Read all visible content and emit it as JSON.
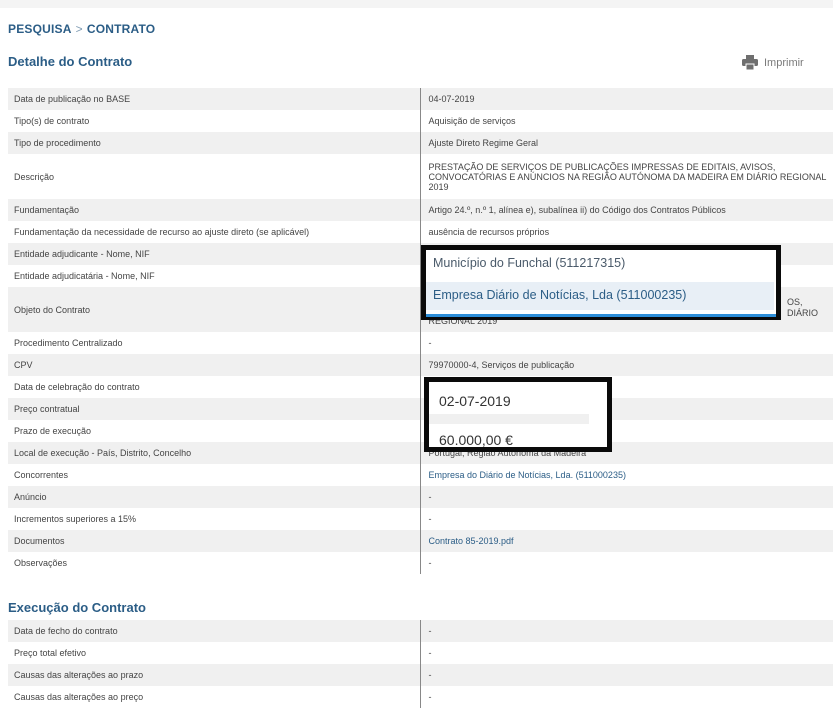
{
  "breadcrumb": {
    "part1": "PESQUISA",
    "sep": ">",
    "part2": "CONTRATO"
  },
  "detail": {
    "title": "Detalhe do Contrato",
    "print_label": "Imprimir",
    "print_icon": "printer-icon",
    "rows": [
      {
        "key": "Data de publicação no BASE",
        "value": "04-07-2019"
      },
      {
        "key": "Tipo(s) de contrato",
        "value": "Aquisição de serviços"
      },
      {
        "key": "Tipo de procedimento",
        "value": "Ajuste Direto Regime Geral"
      },
      {
        "key": "Descrição",
        "value": "PRESTAÇÃO DE SERVIÇOS DE PUBLICAÇÕES IMPRESSAS DE EDITAIS, AVISOS, CONVOCATÓRIAS E ANÚNCIOS NA REGIÃO AUTÓNOMA DA MADEIRA EM DIÁRIO REGIONAL 2019"
      },
      {
        "key": "Fundamentação",
        "value": "Artigo 24.º, n.º 1, alínea e), subalínea ii) do Código dos Contratos Públicos"
      },
      {
        "key": "Fundamentação da necessidade de recurso ao ajuste direto (se aplicável)",
        "value": "ausência de recursos próprios"
      },
      {
        "key": "Entidade adjudicante - Nome, NIF",
        "value": ""
      },
      {
        "key": "Entidade adjudicatária - Nome, NIF",
        "value": ""
      },
      {
        "key": "Objeto do Contrato",
        "value": "REGIONAL 2019"
      },
      {
        "key": "Procedimento Centralizado",
        "value": "-"
      },
      {
        "key": "CPV",
        "value": "79970000-4, Serviços de publicação"
      },
      {
        "key": "Data de celebração do contrato",
        "value": ""
      },
      {
        "key": "Preço contratual",
        "value": ""
      },
      {
        "key": "Prazo de execução",
        "value": ""
      },
      {
        "key": "Local de execução - País, Distrito, Concelho",
        "value": "Portugal, Região Autónoma da Madeira"
      },
      {
        "key": "Concorrentes",
        "value": "Empresa do Diário de Notícias, Lda. (511000235)"
      },
      {
        "key": "Anúncio",
        "value": "-"
      },
      {
        "key": "Incrementos superiores a 15%",
        "value": "-"
      },
      {
        "key": "Documentos",
        "value": "Contrato 85-2019.pdf"
      },
      {
        "key": "Observações",
        "value": "-"
      }
    ],
    "objeto_peek_1": "OS,",
    "objeto_peek_2": "DIÁRIO"
  },
  "execution": {
    "title": "Execução do Contrato",
    "rows": [
      {
        "key": "Data de fecho do contrato",
        "value": "-"
      },
      {
        "key": "Preço total efetivo",
        "value": "-"
      },
      {
        "key": "Causas das alterações ao prazo",
        "value": "-"
      },
      {
        "key": "Causas das alterações ao preço",
        "value": "-"
      }
    ]
  },
  "overlay_entities": {
    "adjudicante": "Município do Funchal (511217315)",
    "adjudicataria": "Empresa Diário de Notícias, Lda (511000235)"
  },
  "overlay_values": {
    "data_celebracao": "02-07-2019",
    "preco": "60.000,00 €"
  }
}
